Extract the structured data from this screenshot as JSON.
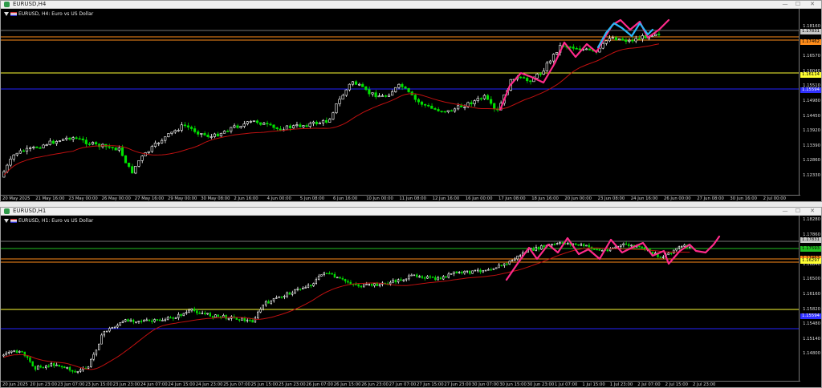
{
  "windows": [
    {
      "title": "EURUSD,H4",
      "label": "EURUSD, H4:  Euro vs US Dollar",
      "price_ticks": [
        "1.18160",
        "1.17180",
        "1.16570",
        "1.16040",
        "1.15510",
        "1.14980",
        "1.14450",
        "1.13920",
        "1.13390",
        "1.12860",
        "1.12330"
      ],
      "tags": [
        {
          "text": "1.17831",
          "color": "#c8c8c8"
        },
        {
          "text": "1.17462",
          "color": "#ff8c1a"
        },
        {
          "text": "1.16114",
          "color": "#ffff33"
        },
        {
          "text": "1.15594",
          "color": "#3030ff"
        }
      ],
      "time_ticks": [
        "20 May 2025",
        "21 May 16:00",
        "23 May 00:00",
        "26 May 00:00",
        "27 May 16:00",
        "29 May 00:00",
        "30 May 08:00",
        "2 Jun 16:00",
        "4 Jun 00:00",
        "5 Jun 08:00",
        "6 Jun 16:00",
        "10 Jun 00:00",
        "11 Jun 08:00",
        "12 Jun 16:00",
        "16 Jun 00:00",
        "17 Jun 08:00",
        "18 Jun 16:00",
        "20 Jun 00:00",
        "23 Jun 08:00",
        "24 Jun 16:00",
        "26 Jun 00:00",
        "27 Jun 08:00",
        "30 Jun 16:00",
        "2 Jul 00:00"
      ],
      "level_colors": {
        "gray": "#9a9a9a",
        "orange": "#ff8c1a",
        "yellow": "#ffff33",
        "blue": "#2323ff"
      }
    },
    {
      "title": "EURUSD,H1",
      "label": "EURUSD, H1:  Euro vs US Dollar",
      "price_ticks": [
        "1.18280",
        "1.17860",
        "1.17180",
        "1.16840",
        "1.16500",
        "1.16160",
        "1.15820",
        "1.15480",
        "1.15140",
        "1.14800"
      ],
      "tags": [
        {
          "text": "1.17831",
          "color": "#c8c8c8"
        },
        {
          "text": "1.17593",
          "color": "#22c022"
        },
        {
          "text": "1.17463",
          "color": "#ff8c1a"
        },
        {
          "text": "1.16297",
          "color": "#ffff33"
        },
        {
          "text": "1.15594",
          "color": "#3030ff"
        }
      ],
      "time_ticks": [
        "20 Jun 2025",
        "20 Jun 23:00",
        "23 Jun 07:00",
        "23 Jun 15:00",
        "23 Jun 23:00",
        "24 Jun 07:00",
        "24 Jun 15:00",
        "24 Jun 23:00",
        "25 Jun 07:00",
        "25 Jun 15:00",
        "25 Jun 23:00",
        "26 Jun 07:00",
        "26 Jun 15:00",
        "26 Jun 23:00",
        "27 Jun 07:00",
        "27 Jun 15:00",
        "27 Jun 23:00",
        "30 Jun 07:00",
        "30 Jun 15:00",
        "30 Jun 23:00",
        "1 Jul 07:00",
        "1 Jul 15:00",
        "1 Jul 23:00",
        "2 Jul 07:00",
        "2 Jul 15:00",
        "2 Jul 23:00"
      ],
      "level_colors": {
        "gray": "#9a9a9a",
        "green": "#22c022",
        "orange": "#ff8c1a",
        "yellow": "#ffff33",
        "blue": "#2323ff"
      }
    }
  ],
  "window_buttons": {
    "min": "—",
    "max": "☐",
    "close": "✕"
  },
  "colors": {
    "bull": "#ffffff",
    "bear": "#00e000",
    "ma": "#c01010",
    "projection_pink": "#ff2a8a",
    "projection_blue": "#29b6f6"
  }
}
